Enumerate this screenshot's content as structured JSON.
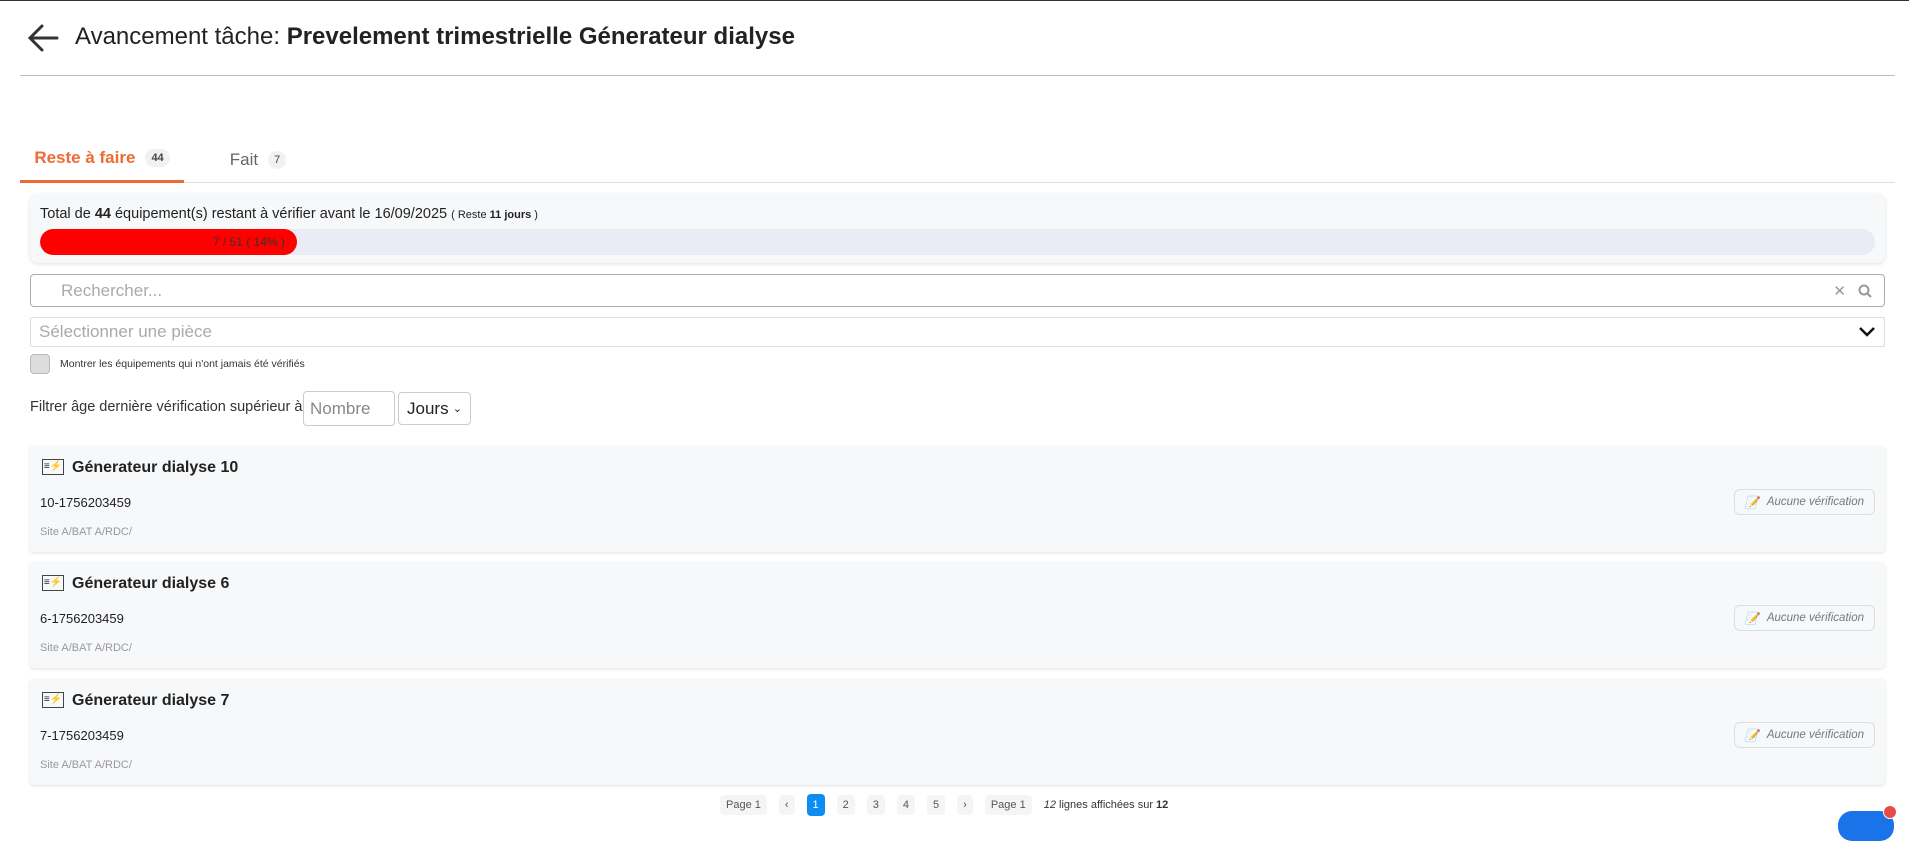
{
  "header": {
    "prefix": "Avancement tâche: ",
    "task": "Prevelement trimestrielle Génerateur dialyse"
  },
  "tabs": [
    {
      "label": "Reste à faire",
      "count": "44"
    },
    {
      "label": "Fait",
      "count": "7"
    }
  ],
  "progress": {
    "t1": "Total de ",
    "count": "44",
    "t2": " équipement(s) restant à vérifier avant le 16/09/2025 ",
    "t3": "( Reste ",
    "days": "11 jours",
    "t4": " )",
    "label": "7 / 51 ( 14% )",
    "percent": 14,
    "color": "#ff0000"
  },
  "search": {
    "placeholder": "Rechercher..."
  },
  "room_select": {
    "placeholder": "Sélectionner une pièce"
  },
  "checkbox_label": "Montrer les équipements qui n'ont jamais été vérifiés",
  "filter": {
    "label": "Filtrer âge dernière vérification supérieur à",
    "placeholder": "Nombre",
    "unit": "Jours"
  },
  "items": [
    {
      "name": "Génerateur dialyse 10",
      "code": "10-1756203459",
      "location": "Site A/BAT A/RDC/",
      "status": "Aucune vérification"
    },
    {
      "name": "Génerateur dialyse 6",
      "code": "6-1756203459",
      "location": "Site A/BAT A/RDC/",
      "status": "Aucune vérification"
    },
    {
      "name": "Génerateur dialyse 7",
      "code": "7-1756203459",
      "location": "Site A/BAT A/RDC/",
      "status": "Aucune vérification"
    }
  ],
  "pagination": {
    "page_label": "Page 1",
    "pages": [
      "1",
      "2",
      "3",
      "4",
      "5"
    ],
    "summary_count": "12",
    "summary_text": " lignes affichées sur ",
    "summary_total": "12"
  }
}
